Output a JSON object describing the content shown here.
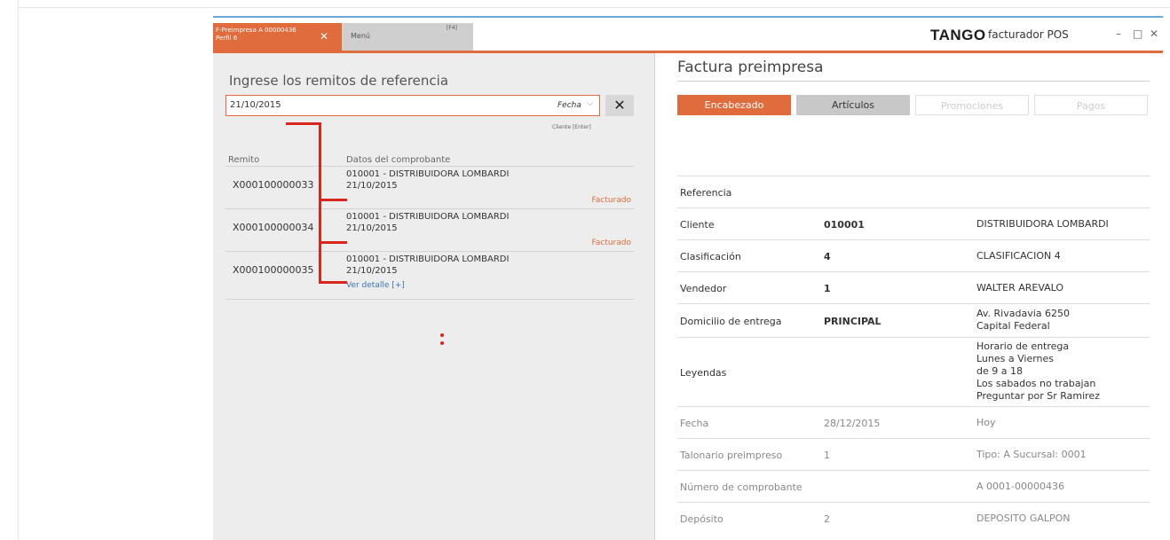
{
  "tabs": [
    {
      "line1": "F-Preimpresa A 00000436",
      "line2": "Perfil 6",
      "close": "✕"
    },
    {
      "label": "Menú",
      "key": "[F4]"
    }
  ],
  "brand": {
    "name": "TANGO",
    "product": "facturador POS"
  },
  "window": {
    "minimize": "–",
    "maximize": "□",
    "close": "✕"
  },
  "left": {
    "title": "Ingrese los remitos de referencia",
    "search_value": "21/10/2015",
    "filter_label": "Fecha",
    "clear": "✕",
    "hint": "Cliente [Enter]",
    "col_remito": "Remito",
    "col_datos": "Datos del comprobante",
    "rows": [
      {
        "remito": "X000100000033",
        "cliente": "010001 - DISTRIBUIDORA LOMBARDI",
        "fecha": "21/10/2015",
        "estado": "Facturado"
      },
      {
        "remito": "X000100000034",
        "cliente": "010001 - DISTRIBUIDORA LOMBARDI",
        "fecha": "21/10/2015",
        "estado": "Facturado"
      },
      {
        "remito": "X000100000035",
        "cliente": "010001 - DISTRIBUIDORA LOMBARDI",
        "fecha": "21/10/2015",
        "detalle": "Ver detalle [+]"
      }
    ]
  },
  "right": {
    "title": "Factura preimpresa",
    "tabs": [
      "Encabezado",
      "Artículos",
      "Promociones",
      "Pagos"
    ],
    "details": [
      {
        "label": "Referencia",
        "value": "",
        "desc": ""
      },
      {
        "label": "Cliente",
        "value": "010001",
        "desc": "DISTRIBUIDORA LOMBARDI"
      },
      {
        "label": "Clasificación",
        "value": "4",
        "desc": "CLASIFICACION 4"
      },
      {
        "label": "Vendedor",
        "value": "1",
        "desc": "WALTER AREVALO"
      },
      {
        "label": "Domicilio de entrega",
        "value": "PRINCIPAL",
        "desc1": "Av. Rivadavia 6250",
        "desc2": "Capital Federal"
      },
      {
        "label": "Leyendas",
        "value": "",
        "lines": [
          "Horario de entrega",
          "Lunes a Viernes",
          "de 9 a 18",
          "Los sabados no trabajan",
          "Preguntar por Sr Ramirez"
        ]
      },
      {
        "label": "Fecha",
        "value": "28/12/2015",
        "desc": "Hoy"
      },
      {
        "label": "Talonario preimpreso",
        "value": "1",
        "desc": "Tipo: A   Sucursal: 0001"
      },
      {
        "label": "Número de comprobante",
        "value": "",
        "desc": "A 0001-00000436"
      },
      {
        "label": "Depósito",
        "value": "2",
        "desc": "DEPOSITO GALPON"
      }
    ]
  }
}
